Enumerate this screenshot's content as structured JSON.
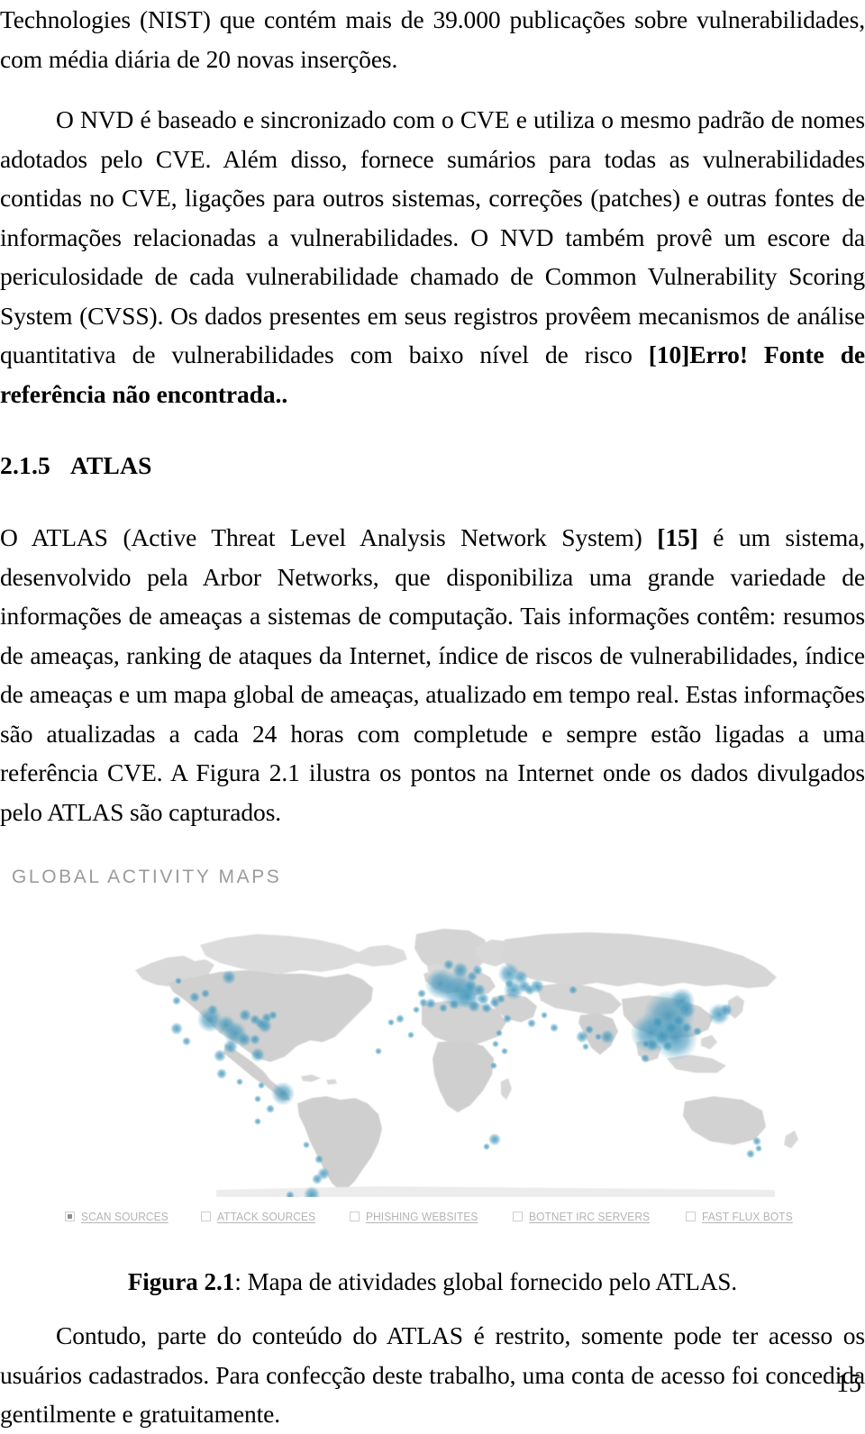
{
  "document": {
    "page_number": "15",
    "paragraphs": {
      "p1_continuation": "Technologies (NIST) que contém mais de 39.000 publicações sobre vulnerabilidades, com média diária de 20 novas inserções.",
      "p2_line_a": "O NVD é baseado e sincronizado com o CVE e utiliza o mesmo padrão de nomes adotados pelo CVE. Além disso, fornece sumários para todas as vulnerabilidades contidas no CVE, ligações para outros sistemas, correções (patches) e outras fontes de informações relacionadas a vulnerabilidades. O NVD também provê um escore da periculosidade de cada vulnerabilidade chamado de Common Vulnerability Scoring System (CVSS). Os dados presentes em seus registros provêem mecanismos de análise quantitativa de vulnerabilidades com baixo nível de risco ",
      "p2_citation": "[10]",
      "p2_error_bold": "Erro! Fonte de referência não encontrada.",
      "p2_tail": ".",
      "p3_head": "O ATLAS (Active Threat Level Analysis Network System) ",
      "p3_citation": "[15]",
      "p3_tail": " é um sistema, desenvolvido pela Arbor Networks, que disponibiliza uma grande variedade de informações de ameaças a sistemas de computação. Tais informações contêm: resumos de ameaças, ranking de ataques da Internet, índice de riscos de vulnerabilidades, índice de ameaças e um mapa global de ameaças, atualizado em tempo real. Estas informações são atualizadas a cada 24 horas com completude e sempre estão ligadas a uma referência CVE. A Figura 2.1 ilustra os pontos na Internet onde os dados divulgados pelo ATLAS são capturados.",
      "p4": "Contudo, parte do conteúdo do ATLAS é restrito, somente pode ter acesso os usuários cadastrados. Para confecção deste trabalho, uma conta de acesso foi concedida gentilmente e gratuitamente."
    },
    "heading": {
      "number": "2.1.5",
      "title": "ATLAS"
    },
    "figure": {
      "map_title": "GLOBAL ACTIVITY MAPS",
      "caption_label": "Figura 2.1",
      "caption_text": ": Mapa de atividades global fornecido pelo ATLAS.",
      "legend": [
        {
          "label": "SCAN SOURCES",
          "checked": true
        },
        {
          "label": "ATTACK SOURCES",
          "checked": false
        },
        {
          "label": "PHISHING WEBSITES",
          "checked": false
        },
        {
          "label": "BOTNET IRC SERVERS",
          "checked": false
        },
        {
          "label": "FAST FLUX BOTS",
          "checked": false
        }
      ],
      "colors": {
        "dot": "#3f93b8",
        "dot_soft": "#5aa7c6",
        "land": "#d2d2d2",
        "land_light": "#e2e2e2",
        "title_text": "#9b9b9b",
        "legend_text": "#b4b4b4"
      }
    }
  }
}
